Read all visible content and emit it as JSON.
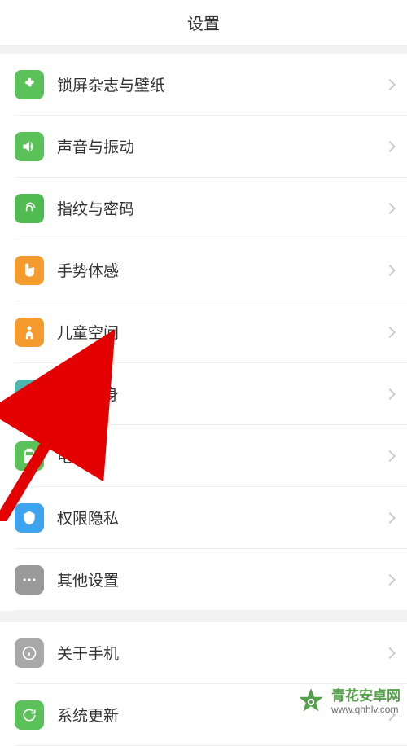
{
  "header": {
    "title": "设置"
  },
  "sections": [
    {
      "items": [
        {
          "id": "lock-wallpaper",
          "label": "锁屏杂志与壁纸",
          "icon": "flower-icon",
          "bg": "#5bc25a"
        },
        {
          "id": "sound-vibration",
          "label": "声音与振动",
          "icon": "sound-icon",
          "bg": "#5bc25a"
        },
        {
          "id": "fingerprint-password",
          "label": "指纹与密码",
          "icon": "fingerprint-icon",
          "bg": "#4fbb50"
        },
        {
          "id": "gesture-motion",
          "label": "手势体感",
          "icon": "gesture-icon",
          "bg": "#f59b2e"
        },
        {
          "id": "kids-space",
          "label": "儿童空间",
          "icon": "kids-icon",
          "bg": "#f59b2e"
        },
        {
          "id": "app-clone",
          "label": "应用分身",
          "icon": "clone-icon",
          "bg": "#4db5ae"
        },
        {
          "id": "battery",
          "label": "电池",
          "icon": "battery-icon",
          "bg": "#5bc25a"
        },
        {
          "id": "permission-privacy",
          "label": "权限隐私",
          "icon": "privacy-icon",
          "bg": "#3fa3f0"
        },
        {
          "id": "other-settings",
          "label": "其他设置",
          "icon": "more-icon",
          "bg": "#9a9a9a"
        }
      ]
    },
    {
      "items": [
        {
          "id": "about-phone",
          "label": "关于手机",
          "icon": "info-icon",
          "bg": "#a8a8a8"
        },
        {
          "id": "system-update",
          "label": "系统更新",
          "icon": "update-icon",
          "bg": "#5bc25a"
        }
      ]
    }
  ],
  "watermark": {
    "line1": "青花安卓网",
    "line2": "www.qhhlv.com"
  }
}
